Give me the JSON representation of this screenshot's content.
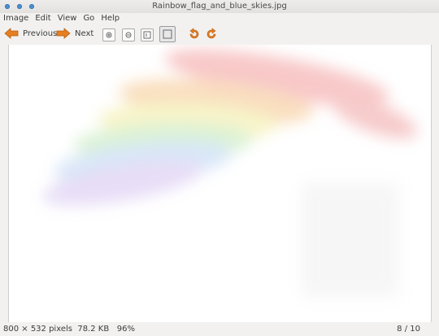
{
  "window": {
    "title": "Rainbow_flag_and_blue_skies.jpg"
  },
  "menu": {
    "items": [
      "Image",
      "Edit",
      "View",
      "Go",
      "Help"
    ]
  },
  "toolbar": {
    "previous_label": "Previous",
    "next_label": "Next"
  },
  "status": {
    "dimensions": "800 × 532 pixels",
    "filesize": "78.2 KB",
    "zoom": "96%",
    "position": "8 / 10"
  },
  "colors": {
    "accent_orange": "#e67e22",
    "window_dot_blue": "#4b8ed6"
  }
}
